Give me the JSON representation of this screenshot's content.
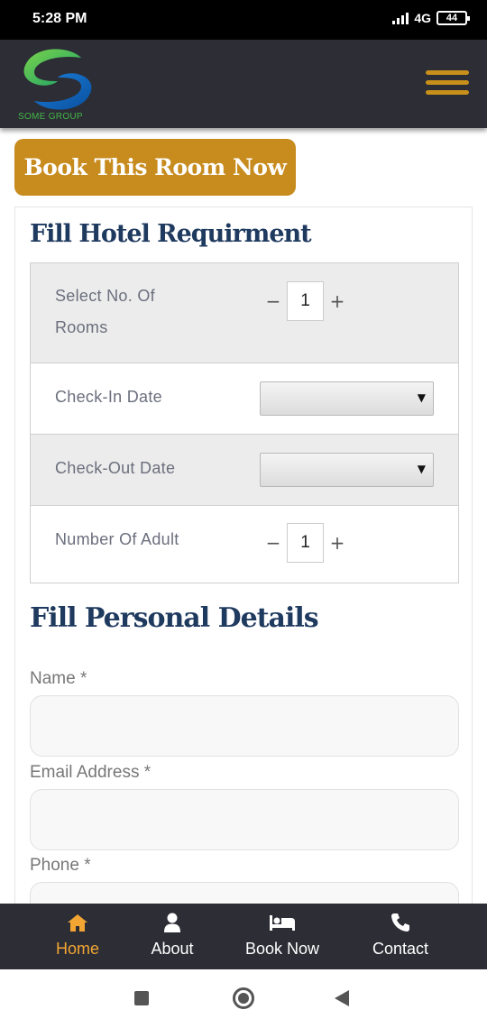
{
  "status_bar": {
    "time": "5:28 PM",
    "network": "4G",
    "battery": "44"
  },
  "header": {
    "logo_text": "SOME GROUP",
    "menu_icon": "hamburger-menu-icon"
  },
  "book_button_label": "Book This Room Now",
  "hotel_section": {
    "title": "Fill Hotel Requirment",
    "rooms": {
      "label": "Select No. Of Rooms",
      "value": "1",
      "minus": "−",
      "plus": "+"
    },
    "checkin": {
      "label": "Check-In Date",
      "caret": "▼"
    },
    "checkout": {
      "label": "Check-Out Date",
      "caret": "▼"
    },
    "adults": {
      "label": "Number Of Adult",
      "value": "1",
      "minus": "−",
      "plus": "+"
    }
  },
  "personal_section": {
    "title": "Fill Personal Details",
    "name_label": "Name *",
    "email_label": "Email Address *",
    "phone_label": "Phone *"
  },
  "bottom_nav": {
    "items": [
      {
        "label": "Home",
        "icon": "home-icon",
        "active": true
      },
      {
        "label": "About",
        "icon": "user-icon",
        "active": false
      },
      {
        "label": "Book Now",
        "icon": "bed-icon",
        "active": false
      },
      {
        "label": "Contact",
        "icon": "phone-icon",
        "active": false
      }
    ]
  },
  "colors": {
    "accent": "#c78b1e",
    "header_bg": "#2c2d35",
    "title": "#1f3a5f",
    "nav_active": "#f2a533"
  }
}
